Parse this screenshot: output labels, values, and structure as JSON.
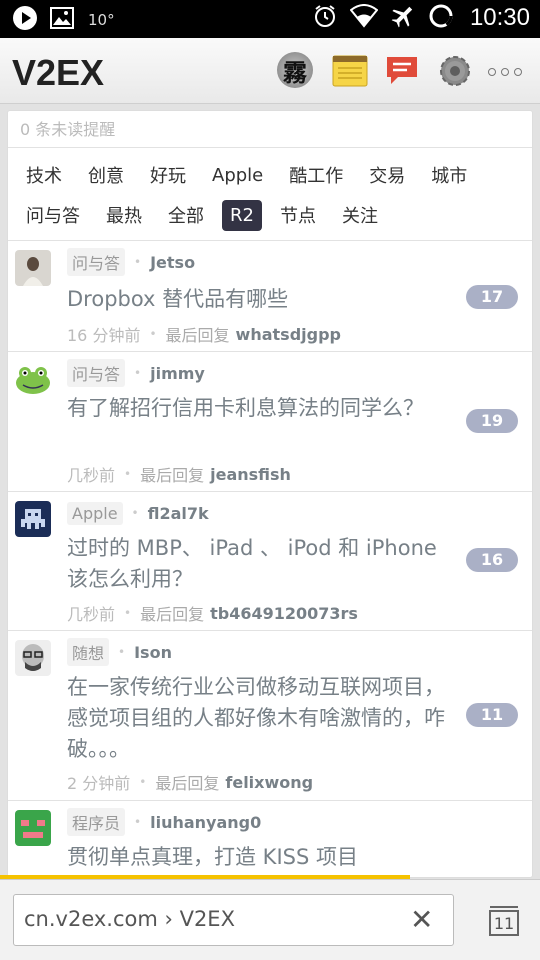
{
  "statusbar": {
    "temperature": "10°",
    "time": "10:30"
  },
  "header": {
    "logo": "V2EX",
    "avatar_char": "霧"
  },
  "notification": "0 条未读提醒",
  "tabs": {
    "row1": [
      {
        "label": "技术"
      },
      {
        "label": "创意"
      },
      {
        "label": "好玩"
      },
      {
        "label": "Apple"
      },
      {
        "label": "酷工作"
      },
      {
        "label": "交易"
      },
      {
        "label": "城市"
      }
    ],
    "row2": [
      {
        "label": "问与答"
      },
      {
        "label": "最热"
      },
      {
        "label": "全部"
      },
      {
        "label": "R2",
        "active": true
      },
      {
        "label": "节点"
      },
      {
        "label": "关注"
      }
    ]
  },
  "topics": [
    {
      "node": "问与答",
      "author": "Jetso",
      "title": "Dropbox 替代品有哪些",
      "time": "16 分钟前",
      "last_reply_label": "最后回复",
      "last_reply": "whatsdjgpp",
      "replies": "17"
    },
    {
      "node": "问与答",
      "author": "jimmy",
      "title": "有了解招行信用卡利息算法的同学么？",
      "time": "几秒前",
      "last_reply_label": "最后回复",
      "last_reply": "jeansfish",
      "replies": "19"
    },
    {
      "node": "Apple",
      "author": "fl2al7k",
      "title": "过时的 MBP、 iPad 、 iPod 和 iPhone 该怎么利用？",
      "time": "几秒前",
      "last_reply_label": "最后回复",
      "last_reply": "tb4649120073rs",
      "replies": "16"
    },
    {
      "node": "随想",
      "author": "Ison",
      "title": "在一家传统行业公司做移动互联网项目，感觉项目组的人都好像木有啥激情的，咋破。。。",
      "time": "2 分钟前",
      "last_reply_label": "最后回复",
      "last_reply": "felixwong",
      "replies": "11"
    },
    {
      "node": "程序员",
      "author": "liuhanyang0",
      "title": "贯彻单点真理，打造 KISS 项目"
    }
  ],
  "bottombar": {
    "url": "cn.v2ex.com › V2EX",
    "tab_count": "11"
  },
  "colors": {
    "accent": "#334",
    "count_badge": "#aab0c6",
    "progress": "#f5c200"
  }
}
